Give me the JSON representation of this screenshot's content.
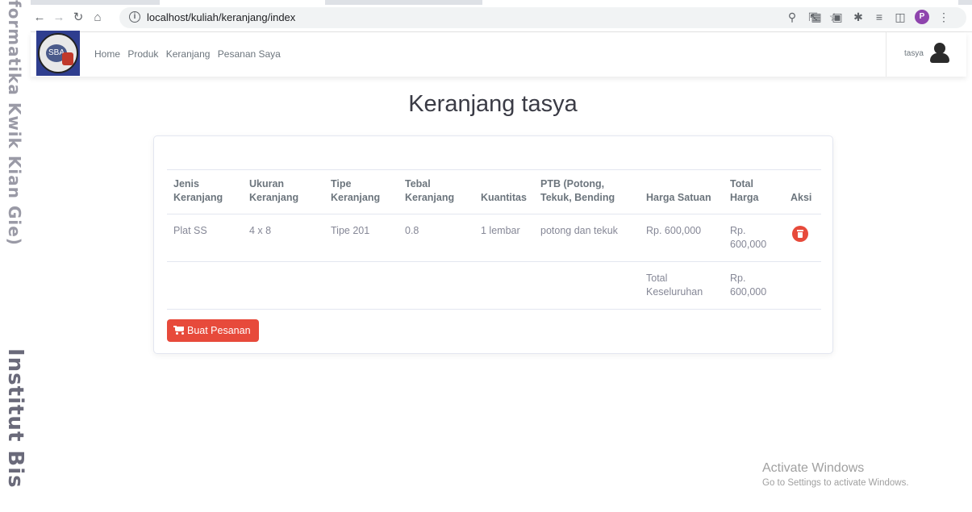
{
  "side_watermark": {
    "line1": "formatika Kwik Kian Gie)",
    "line2": "Institut Bis"
  },
  "browser": {
    "url": "localhost/kuliah/keranjang/index",
    "profile_initial": "P"
  },
  "navbar": {
    "logo_text": "SBA",
    "links": [
      "Home",
      "Produk",
      "Keranjang",
      "Pesanan Saya"
    ],
    "username": "tasya"
  },
  "page": {
    "title": "Keranjang tasya"
  },
  "cart_table": {
    "headers": [
      "Jenis Keranjang",
      "Ukuran Keranjang",
      "Tipe Keranjang",
      "Tebal Keranjang",
      "Kuantitas",
      "PTB (Potong, Tekuk, Bending",
      "Harga Satuan",
      "Total Harga",
      "Aksi"
    ],
    "rows": [
      {
        "jenis": "Plat SS",
        "ukuran": "4 x 8",
        "tipe": "Tipe 201",
        "tebal": "0.8",
        "kuantitas": "1 lembar",
        "ptb": "potong dan tekuk",
        "harga_satuan": "Rp. 600,000",
        "total_harga": "Rp. 600,000"
      }
    ],
    "total_label": "Total Keseluruhan",
    "total_value": "Rp. 600,000"
  },
  "actions": {
    "order_button": "Buat Pesanan"
  },
  "os_watermark": {
    "title": "Activate Windows",
    "subtitle": "Go to Settings to activate Windows."
  },
  "colors": {
    "danger": "#e74a3b",
    "text_muted": "#858796",
    "heading": "#3a3b45"
  }
}
